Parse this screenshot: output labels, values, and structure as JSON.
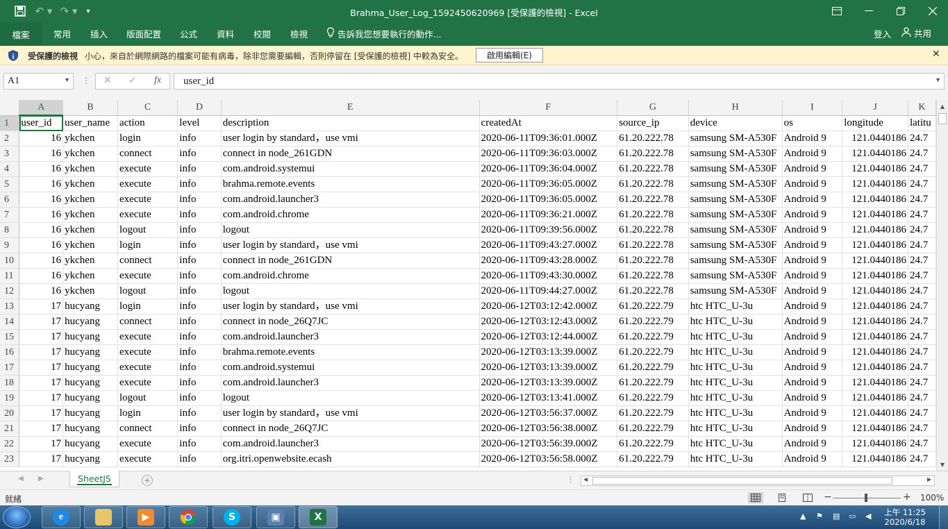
{
  "app": {
    "window_title": "Brahma_User_Log_1592450620969  [受保護的檢視] - Excel",
    "colors": {
      "excel_green": "#217346",
      "protected_bar": "#fff4ce"
    }
  },
  "ribbon": {
    "file_tab": "檔案",
    "tabs": [
      "常用",
      "插入",
      "版面配置",
      "公式",
      "資料",
      "校閱",
      "檢視"
    ],
    "tell_me": "告訴我您想要執行的動作...",
    "sign_in": "登入",
    "share": "共用"
  },
  "protected_view": {
    "title": "受保護的檢視",
    "message": "小心，來自於網際網路的檔案可能有病毒，除非您需要編輯，否則停留在 [受保護的檢視] 中較為安全。",
    "enable_button": "啟用編輯(E)"
  },
  "formula_bar": {
    "name_box": "A1",
    "fx_label": "fx",
    "value": "user_id"
  },
  "grid": {
    "active_cell": "A1",
    "columns": [
      "A",
      "B",
      "C",
      "D",
      "E",
      "F",
      "G",
      "H",
      "I",
      "J",
      "K"
    ],
    "header_row": [
      "user_id",
      "user_name",
      "action",
      "level",
      "description",
      "createdAt",
      "source_ip",
      "device",
      "os",
      "longitude",
      "latitu"
    ],
    "rows": [
      [
        "2",
        "16",
        "ykchen",
        "login",
        "info",
        "user login by standard，use vmi",
        "2020-06-11T09:36:01.000Z",
        "61.20.222.78",
        "samsung SM-A530F",
        "Android 9",
        "121.0440186",
        "24.7"
      ],
      [
        "3",
        "16",
        "ykchen",
        "connect",
        "info",
        "connect in node_261GDN",
        "2020-06-11T09:36:03.000Z",
        "61.20.222.78",
        "samsung SM-A530F",
        "Android 9",
        "121.0440186",
        "24.7"
      ],
      [
        "4",
        "16",
        "ykchen",
        "execute",
        "info",
        "com.android.systemui",
        "2020-06-11T09:36:04.000Z",
        "61.20.222.78",
        "samsung SM-A530F",
        "Android 9",
        "121.0440186",
        "24.7"
      ],
      [
        "5",
        "16",
        "ykchen",
        "execute",
        "info",
        "brahma.remote.events",
        "2020-06-11T09:36:05.000Z",
        "61.20.222.78",
        "samsung SM-A530F",
        "Android 9",
        "121.0440186",
        "24.7"
      ],
      [
        "6",
        "16",
        "ykchen",
        "execute",
        "info",
        "com.android.launcher3",
        "2020-06-11T09:36:05.000Z",
        "61.20.222.78",
        "samsung SM-A530F",
        "Android 9",
        "121.0440186",
        "24.7"
      ],
      [
        "7",
        "16",
        "ykchen",
        "execute",
        "info",
        "com.android.chrome",
        "2020-06-11T09:36:21.000Z",
        "61.20.222.78",
        "samsung SM-A530F",
        "Android 9",
        "121.0440186",
        "24.7"
      ],
      [
        "8",
        "16",
        "ykchen",
        "logout",
        "info",
        "logout",
        "2020-06-11T09:39:56.000Z",
        "61.20.222.78",
        "samsung SM-A530F",
        "Android 9",
        "121.0440186",
        "24.7"
      ],
      [
        "9",
        "16",
        "ykchen",
        "login",
        "info",
        "user login by standard，use vmi",
        "2020-06-11T09:43:27.000Z",
        "61.20.222.78",
        "samsung SM-A530F",
        "Android 9",
        "121.0440186",
        "24.7"
      ],
      [
        "10",
        "16",
        "ykchen",
        "connect",
        "info",
        "connect in node_261GDN",
        "2020-06-11T09:43:28.000Z",
        "61.20.222.78",
        "samsung SM-A530F",
        "Android 9",
        "121.0440186",
        "24.7"
      ],
      [
        "11",
        "16",
        "ykchen",
        "execute",
        "info",
        "com.android.chrome",
        "2020-06-11T09:43:30.000Z",
        "61.20.222.78",
        "samsung SM-A530F",
        "Android 9",
        "121.0440186",
        "24.7"
      ],
      [
        "12",
        "16",
        "ykchen",
        "logout",
        "info",
        "logout",
        "2020-06-11T09:44:27.000Z",
        "61.20.222.78",
        "samsung SM-A530F",
        "Android 9",
        "121.0440186",
        "24.7"
      ],
      [
        "13",
        "17",
        "hucyang",
        "login",
        "info",
        "user login by standard，use vmi",
        "2020-06-12T03:12:42.000Z",
        "61.20.222.79",
        "htc HTC_U-3u",
        "Android 9",
        "121.0440186",
        "24.7"
      ],
      [
        "14",
        "17",
        "hucyang",
        "connect",
        "info",
        "connect in node_26Q7JC",
        "2020-06-12T03:12:43.000Z",
        "61.20.222.79",
        "htc HTC_U-3u",
        "Android 9",
        "121.0440186",
        "24.7"
      ],
      [
        "15",
        "17",
        "hucyang",
        "execute",
        "info",
        "com.android.launcher3",
        "2020-06-12T03:12:44.000Z",
        "61.20.222.79",
        "htc HTC_U-3u",
        "Android 9",
        "121.0440186",
        "24.7"
      ],
      [
        "16",
        "17",
        "hucyang",
        "execute",
        "info",
        "brahma.remote.events",
        "2020-06-12T03:13:39.000Z",
        "61.20.222.79",
        "htc HTC_U-3u",
        "Android 9",
        "121.0440186",
        "24.7"
      ],
      [
        "17",
        "17",
        "hucyang",
        "execute",
        "info",
        "com.android.systemui",
        "2020-06-12T03:13:39.000Z",
        "61.20.222.79",
        "htc HTC_U-3u",
        "Android 9",
        "121.0440186",
        "24.7"
      ],
      [
        "18",
        "17",
        "hucyang",
        "execute",
        "info",
        "com.android.launcher3",
        "2020-06-12T03:13:39.000Z",
        "61.20.222.79",
        "htc HTC_U-3u",
        "Android 9",
        "121.0440186",
        "24.7"
      ],
      [
        "19",
        "17",
        "hucyang",
        "logout",
        "info",
        "logout",
        "2020-06-12T03:13:41.000Z",
        "61.20.222.79",
        "htc HTC_U-3u",
        "Android 9",
        "121.0440186",
        "24.7"
      ],
      [
        "20",
        "17",
        "hucyang",
        "login",
        "info",
        "user login by standard，use vmi",
        "2020-06-12T03:56:37.000Z",
        "61.20.222.79",
        "htc HTC_U-3u",
        "Android 9",
        "121.0440186",
        "24.7"
      ],
      [
        "21",
        "17",
        "hucyang",
        "connect",
        "info",
        "connect in node_26Q7JC",
        "2020-06-12T03:56:38.000Z",
        "61.20.222.79",
        "htc HTC_U-3u",
        "Android 9",
        "121.0440186",
        "24.7"
      ],
      [
        "22",
        "17",
        "hucyang",
        "execute",
        "info",
        "com.android.launcher3",
        "2020-06-12T03:56:39.000Z",
        "61.20.222.79",
        "htc HTC_U-3u",
        "Android 9",
        "121.0440186",
        "24.7"
      ],
      [
        "23",
        "17",
        "hucyang",
        "execute",
        "info",
        "org.itri.openwebsite.ecash",
        "2020-06-12T03:56:58.000Z",
        "61.20.222.79",
        "htc HTC_U-3u",
        "Android 9",
        "121.0440186",
        "24.7"
      ]
    ]
  },
  "sheets": {
    "tabs": [
      "SheetJS"
    ],
    "active": "SheetJS"
  },
  "status_bar": {
    "ready": "就緒",
    "zoom": "100%"
  },
  "taskbar": {
    "apps": [
      "internet-explorer",
      "file-explorer",
      "media-player",
      "chrome",
      "skype",
      "network-tool",
      "excel"
    ],
    "clock_time": "上午 11:25",
    "clock_date": "2020/6/18"
  }
}
